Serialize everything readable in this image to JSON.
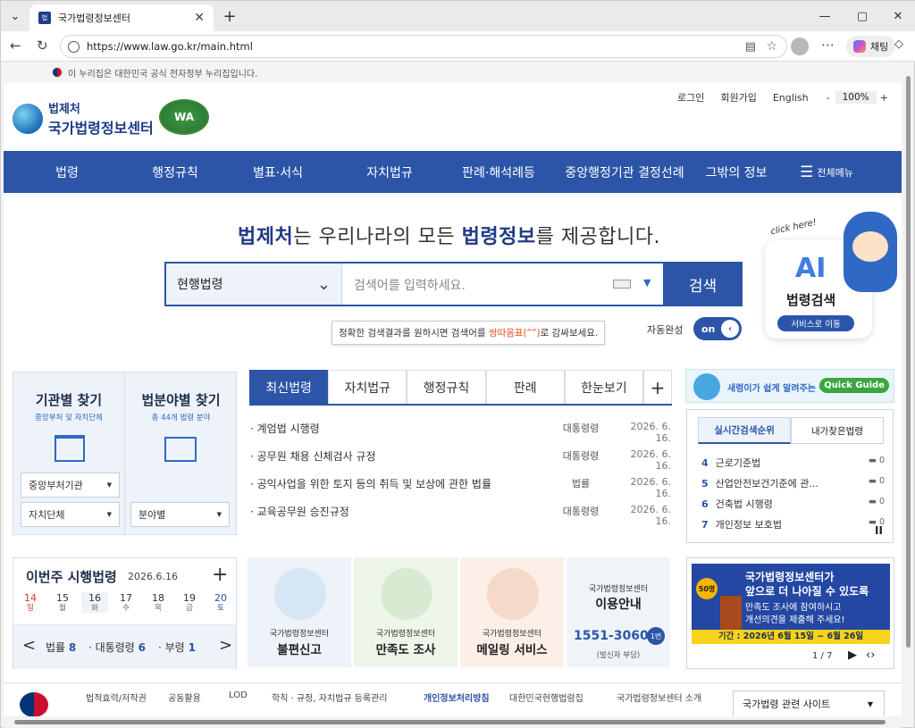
{
  "browser": {
    "tab_title": "국가법령정보센터",
    "favicon_text": "법",
    "url": "https://www.law.go.kr/main.html",
    "chat_label": "채팅",
    "zoom": "100%"
  },
  "gov_banner": "이 누리집은 대한민국 공식 전자정부 누리집입니다.",
  "util": {
    "login": "로그인",
    "join": "회원가입",
    "english": "English",
    "zoom_minus": "-",
    "zoom": "100%",
    "zoom_plus": "+"
  },
  "logo": {
    "line1": "법제처",
    "line2": "국가법령정보센터",
    "wa": "WA"
  },
  "gnb": {
    "items": [
      "법령",
      "행정규칙",
      "별표·서식",
      "자치법규",
      "판례·해석례등",
      "중앙행정기관 결정선례",
      "그밖의 정보"
    ],
    "all_menu": "전체메뉴"
  },
  "hero": {
    "headline_a": "법제처",
    "headline_b": "는 우리나라의 모든 ",
    "headline_c": "법령정보",
    "headline_d": "를 제공합니다.",
    "select_value": "현행법령",
    "placeholder": "검색어를 입력하세요.",
    "search_btn": "검색",
    "tip_a": "정확한 검색결과를 원하시면 검색어를 ",
    "tip_b": "쌍따옴표(“”)",
    "tip_c": "로 감싸보세요.",
    "auto_label": "자동완성",
    "toggle": "on",
    "click_here": "click here!",
    "ai_big": "AI",
    "ai_name": "법령검색",
    "ai_btn": "서비스로 이동"
  },
  "find": {
    "org_title": "기관별 찾기",
    "org_sub": "중앙부처 및 자치단체",
    "org_sel1": "중앙부처기관",
    "org_sel2": "자치단체",
    "field_title": "법분야별 찾기",
    "field_sub": "총 44개 법령 분야",
    "field_sel": "분야별"
  },
  "news": {
    "tabs": [
      "최신법령",
      "자치법규",
      "행정규칙",
      "판례",
      "한눈보기"
    ],
    "plus": "+",
    "rows": [
      {
        "title": "· 계엄법 시행령",
        "cat": "대통령령",
        "date": "2026. 6. 16."
      },
      {
        "title": "· 공무원 채용 신체검사 규정",
        "cat": "대통령령",
        "date": "2026. 6. 16."
      },
      {
        "title": "· 공익사업을 위한 토지 등의 취득 및 보상에 관한 법률",
        "cat": "법률",
        "date": "2026. 6. 16."
      },
      {
        "title": "· 교육공무원 승진규정",
        "cat": "대통령령",
        "date": "2026. 6. 16."
      }
    ]
  },
  "quick_guide": {
    "text": "새령이가 쉽게 알려주는 국법",
    "pill": "Quick Guide"
  },
  "rank": {
    "tab1": "실시간검색순위",
    "tab2": "내가찾은법령",
    "rows": [
      {
        "n": "4",
        "name": "근로기준법",
        "d": "0"
      },
      {
        "n": "5",
        "name": "산업안전보건기준에 관...",
        "d": "0"
      },
      {
        "n": "6",
        "name": "건축법 시행령",
        "d": "0"
      },
      {
        "n": "7",
        "name": "개인정보 보호법",
        "d": "0"
      }
    ],
    "pause": "II"
  },
  "week": {
    "title": "이번주 시행법령",
    "date": "2026.6.16",
    "plus": "+",
    "days": [
      {
        "n": "14",
        "w": "일"
      },
      {
        "n": "15",
        "w": "월"
      },
      {
        "n": "16",
        "w": "화"
      },
      {
        "n": "17",
        "w": "수"
      },
      {
        "n": "18",
        "w": "목"
      },
      {
        "n": "19",
        "w": "금"
      },
      {
        "n": "20",
        "w": "토"
      }
    ],
    "law_label": "법률",
    "law_n": "8",
    "pres_label": "대통령령",
    "pres_n": "6",
    "min_label": "부령",
    "min_n": "1",
    "prev": "<",
    "next": ">"
  },
  "cards": [
    {
      "lbl": "국가법령정보센터",
      "big": "불편신고"
    },
    {
      "lbl": "국가법령정보센터",
      "big": "만족도 조사"
    },
    {
      "lbl": "국가법령정보센터",
      "big": "메일링 서비스"
    }
  ],
  "contact": {
    "lbl": "국가법령정보센터",
    "big": "이용안내",
    "phone": "1551-3060",
    "badge": "1번",
    "note": "(발신자 부담)"
  },
  "promo": {
    "badge": "50명",
    "line1": "국가법령정보센터가",
    "line2": "앞으로 더 나아질 수 있도록",
    "line3": "만족도 조사에 참여하시고",
    "line4": "개선의견을 제출해 주세요!",
    "period": "기간 : 2026년 6월 15일 ~ 6월 26일",
    "page": "1 / 7"
  },
  "footer": {
    "links": [
      "법적효력/저작권",
      "공동활용",
      "LOD",
      "학칙 · 규정, 자치법규 등록관리",
      "개인정보처리방침",
      "대한민국현행법령집",
      "국가법령정보센터 소개"
    ],
    "site_select": "국가법령 관련 사이트"
  }
}
